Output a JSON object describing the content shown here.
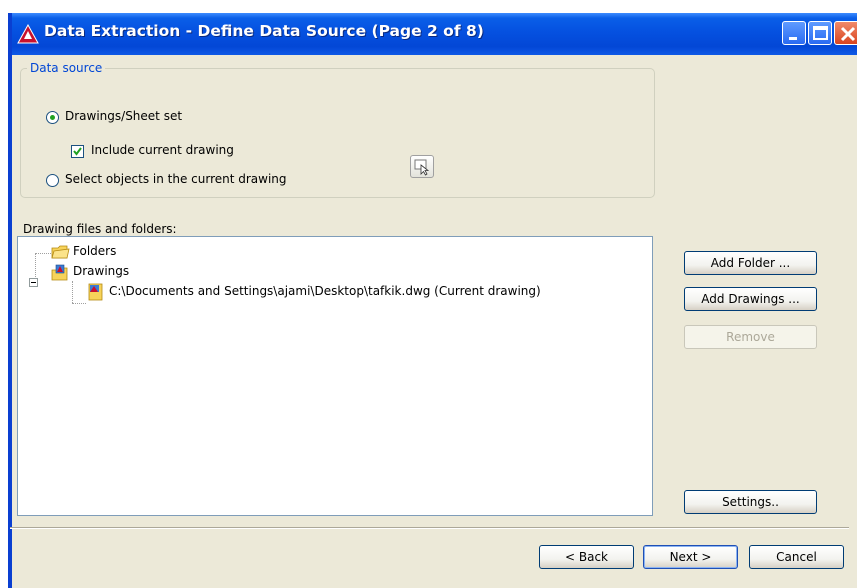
{
  "window": {
    "title": "Data Extraction - Define Data Source (Page 2 of 8)"
  },
  "data_source": {
    "legend": "Data source",
    "option_drawings": "Drawings/Sheet set",
    "include_current": "Include current drawing",
    "option_select": "Select objects in the current drawing",
    "selected_option": "Drawings/Sheet set",
    "include_current_checked": true
  },
  "files": {
    "label": "Drawing files and folders:",
    "tree": {
      "folders": "Folders",
      "drawings": "Drawings",
      "drawing_item": "C:\\Documents and Settings\\ajami\\Desktop\\tafkik.dwg (Current drawing)"
    }
  },
  "buttons": {
    "add_folder": "Add Folder ...",
    "add_drawings": "Add Drawings ...",
    "remove": "Remove",
    "settings": "Settings..",
    "back": "< Back",
    "next": "Next >",
    "cancel": "Cancel"
  },
  "colors": {
    "titlebar": "#0551e0",
    "accent_text": "#0046d5",
    "dialog_bg": "#ece9d8"
  },
  "icons": {
    "app": "autocad-logo-icon",
    "minimize": "minimize-icon",
    "maximize": "maximize-icon",
    "close": "close-icon",
    "pick": "select-objects-icon",
    "folder": "folder-icon",
    "drawings": "drawings-icon",
    "dwg": "dwg-file-icon"
  }
}
